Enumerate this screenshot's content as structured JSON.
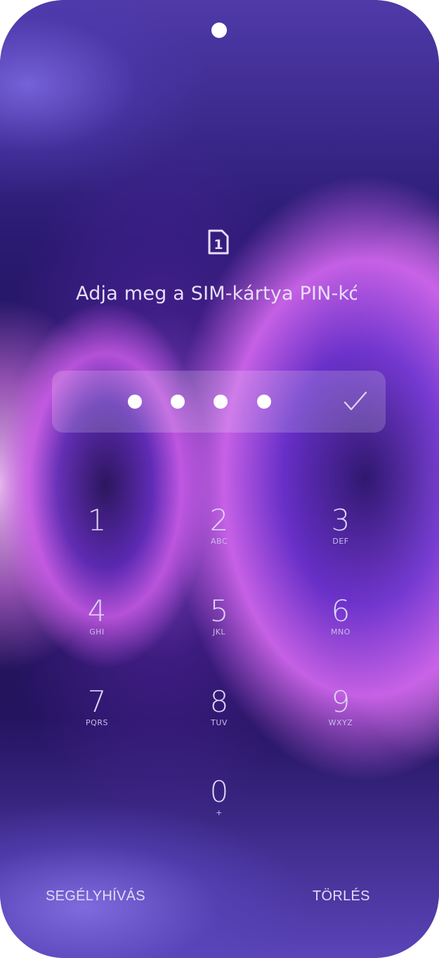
{
  "prompt_text": "Adja meg a SIM-kártya PIN-kódját",
  "sim_icon_label": "1",
  "pin": {
    "entered_digits": 4,
    "confirm_icon": "check-icon"
  },
  "keypad": [
    {
      "digit": "1",
      "letters": ""
    },
    {
      "digit": "2",
      "letters": "ABC"
    },
    {
      "digit": "3",
      "letters": "DEF"
    },
    {
      "digit": "4",
      "letters": "GHI"
    },
    {
      "digit": "5",
      "letters": "JKL"
    },
    {
      "digit": "6",
      "letters": "MNO"
    },
    {
      "digit": "7",
      "letters": "PQRS"
    },
    {
      "digit": "8",
      "letters": "TUV"
    },
    {
      "digit": "9",
      "letters": "WXYZ"
    },
    {
      "digit": "0",
      "letters": "+"
    }
  ],
  "buttons": {
    "emergency": "SEGÉLYHÍVÁS",
    "delete": "TÖRLÉS"
  },
  "colors": {
    "text": "#e8def6",
    "accent": "#ffffff"
  }
}
